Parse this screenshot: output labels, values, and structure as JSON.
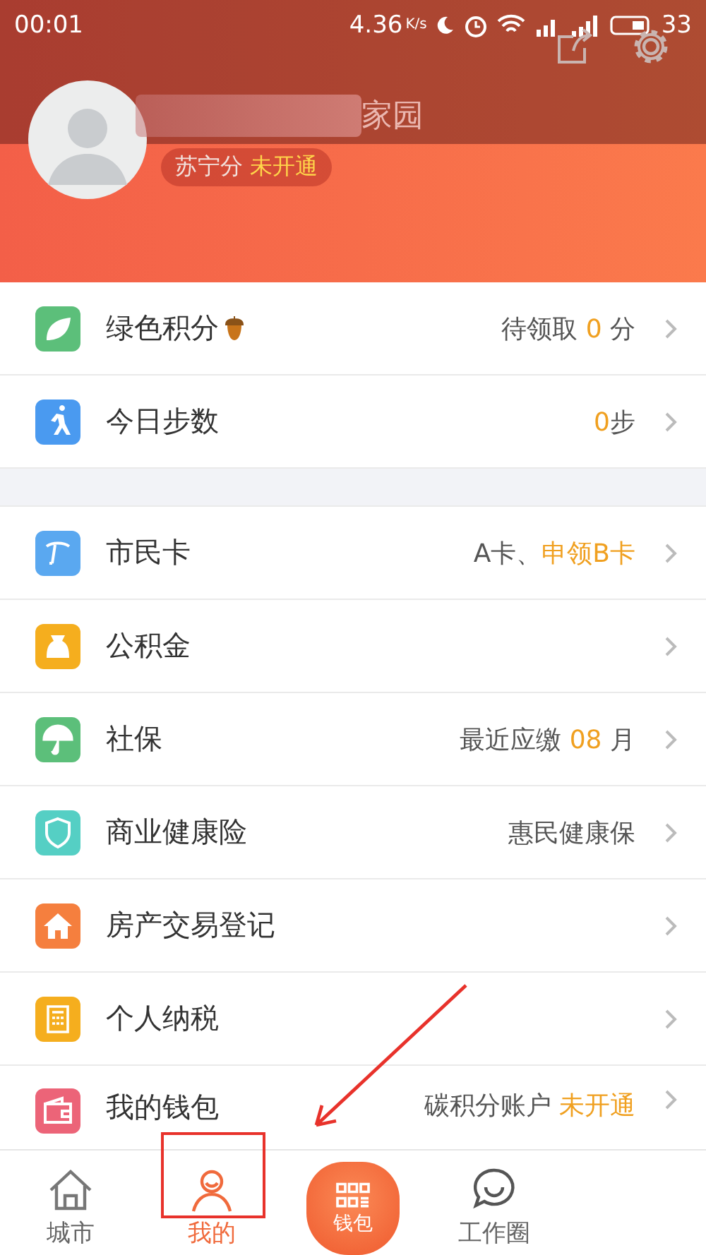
{
  "status_bar": {
    "time": "00:01",
    "speed": "4.36",
    "speed_unit": "K/s",
    "battery": "33"
  },
  "profile": {
    "name": "家园",
    "badge": {
      "label": "苏宁分",
      "status": "未开通"
    }
  },
  "groups": [
    [
      {
        "title": "绿色积分",
        "acorn": true,
        "color": "#5cbf7a",
        "value": [
          {
            "text": "待领取 ",
            "accent": false
          },
          {
            "text": "0",
            "accent": true
          },
          {
            "text": " 分",
            "accent": false
          }
        ]
      },
      {
        "title": "今日步数",
        "acorn": false,
        "color": "#4a9af0",
        "value": [
          {
            "text": "0",
            "accent": true
          },
          {
            "text": "步",
            "accent": false
          }
        ]
      }
    ],
    [
      {
        "title": "市民卡",
        "acorn": false,
        "color": "#5aa8f0",
        "value": [
          {
            "text": "A卡、",
            "accent": false
          },
          {
            "text": "申领B卡",
            "accent": true
          }
        ]
      },
      {
        "title": "公积金",
        "acorn": false,
        "color": "#f5ae1e"
      },
      {
        "title": "社保",
        "acorn": false,
        "color": "#5cbf7a",
        "value": [
          {
            "text": "最近应缴 ",
            "accent": false
          },
          {
            "text": "08",
            "accent": true
          },
          {
            "text": " 月",
            "accent": false
          }
        ]
      },
      {
        "title": "商业健康险",
        "acorn": false,
        "color": "#55cfc4",
        "value": [
          {
            "text": "惠民健康保",
            "accent": false
          }
        ]
      },
      {
        "title": "房产交易登记",
        "acorn": false,
        "color": "#f57f3e"
      },
      {
        "title": "个人纳税",
        "acorn": false,
        "color": "#f5ae1e"
      },
      {
        "title": "我的钱包",
        "acorn": false,
        "color": "#ec6478",
        "value": [
          {
            "text": "碳积分账户 ",
            "accent": false
          },
          {
            "text": "未开通",
            "accent": true
          }
        ]
      }
    ]
  ],
  "tabs": [
    {
      "label": "城市",
      "selected": false,
      "kind": "home"
    },
    {
      "label": "我的",
      "selected": true,
      "kind": "person"
    },
    {
      "label": "钱包",
      "selected": false,
      "kind": "center"
    },
    {
      "label": "工作圈",
      "selected": false,
      "kind": "chat"
    }
  ],
  "annotations": {
    "highlight_box": true,
    "arrow": true
  }
}
